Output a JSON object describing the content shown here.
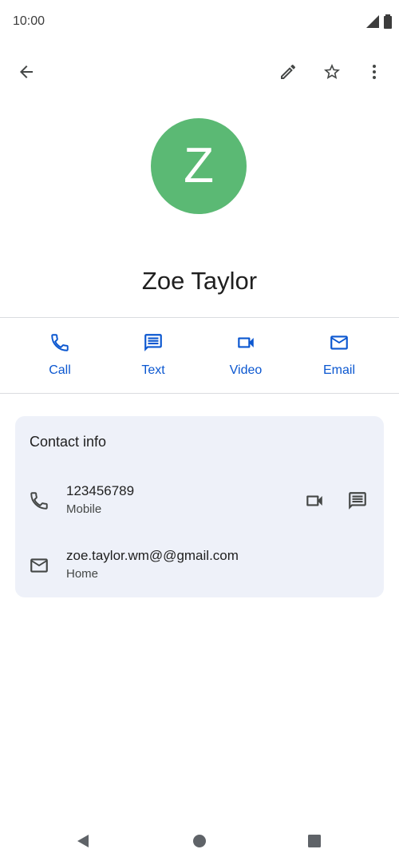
{
  "status_bar": {
    "time": "10:00",
    "icons": [
      "signal-icon",
      "battery-icon"
    ]
  },
  "toolbar": {
    "icons": [
      "back-arrow-icon",
      "edit-pencil-icon",
      "star-outline-icon",
      "more-vert-icon"
    ]
  },
  "contact": {
    "avatar_letter": "Z",
    "avatar_color": "#5bb974",
    "name": "Zoe Taylor"
  },
  "actions": [
    {
      "label": "Call",
      "icon": "phone-icon"
    },
    {
      "label": "Text",
      "icon": "message-icon"
    },
    {
      "label": "Video",
      "icon": "videocam-icon"
    },
    {
      "label": "Email",
      "icon": "email-icon"
    }
  ],
  "contact_info": {
    "title": "Contact info",
    "phone": {
      "value": "123456789",
      "type": "Mobile"
    },
    "email": {
      "value": "zoe.taylor.wm@@gmail.com",
      "type": "Home"
    }
  },
  "colors": {
    "accent": "#0b57d0",
    "card_background": "#eef1f9",
    "divider": "#dadce0"
  },
  "nav_bar": {
    "icons": [
      "nav-back-icon",
      "nav-home-icon",
      "nav-recents-icon"
    ]
  }
}
